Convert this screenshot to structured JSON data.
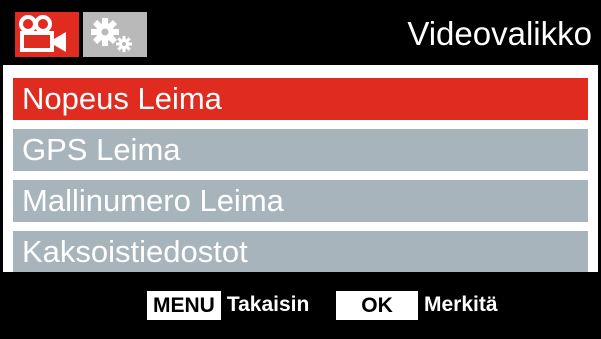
{
  "header": {
    "title": "Videovalikko",
    "tabs": [
      {
        "icon": "video-camera-icon",
        "active": true,
        "color": "#e02b20"
      },
      {
        "icon": "settings-gears-icon",
        "active": false,
        "color": "#b9b9b9"
      }
    ]
  },
  "menu": {
    "items": [
      {
        "label": "Nopeus Leima",
        "selected": true
      },
      {
        "label": "GPS Leima",
        "selected": false
      },
      {
        "label": "Mallinumero Leima",
        "selected": false
      },
      {
        "label": "Kaksoistiedostot",
        "selected": false
      }
    ],
    "selected_color": "#e02b20",
    "item_color": "#a8b4bb"
  },
  "footer": {
    "menu_key": "MENU",
    "menu_action": "Takaisin",
    "ok_key": "OK",
    "ok_action": "Merkitä"
  }
}
